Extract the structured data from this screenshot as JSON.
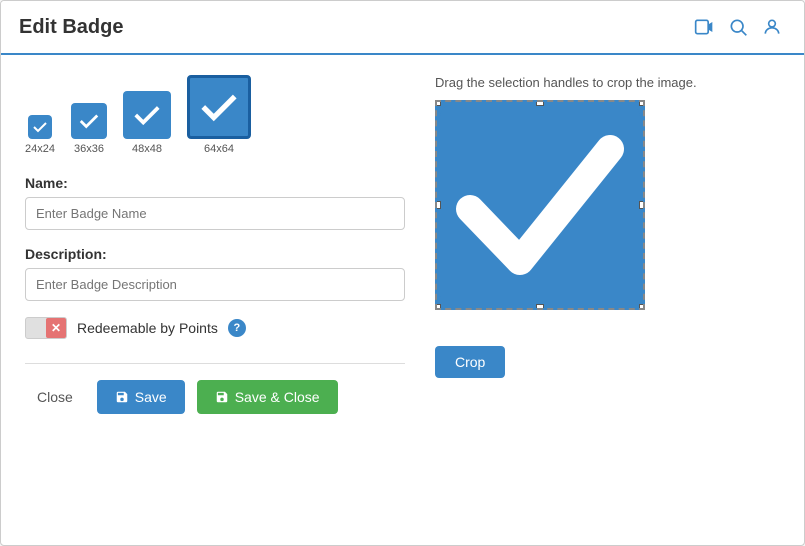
{
  "header": {
    "title": "Edit Badge",
    "icons": [
      "video-icon",
      "search-icon",
      "user-icon"
    ]
  },
  "badge_sizes": [
    {
      "label": "24x24",
      "size": 24,
      "active": false
    },
    {
      "label": "36x36",
      "size": 36,
      "active": false
    },
    {
      "label": "48x48",
      "size": 48,
      "active": false
    },
    {
      "label": "64x64",
      "size": 64,
      "active": true
    }
  ],
  "form": {
    "name_label": "Name:",
    "name_placeholder": "Enter Badge Name",
    "description_label": "Description:",
    "description_placeholder": "Enter Badge Description"
  },
  "toggle": {
    "label": "Redeemable by Points",
    "help_text": "?"
  },
  "buttons": {
    "close": "Close",
    "save": "Save",
    "save_close": "Save & Close"
  },
  "crop": {
    "hint": "Drag the selection handles to crop the image.",
    "button": "Crop"
  }
}
